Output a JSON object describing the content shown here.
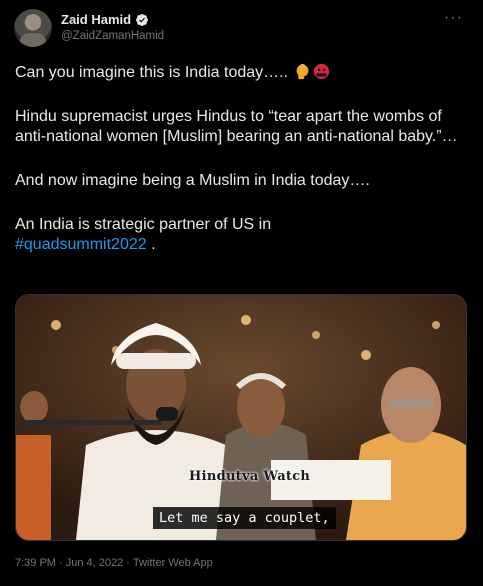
{
  "author": {
    "name": "Zaid Hamid",
    "handle": "@ZaidZamanHamid",
    "verified_icon": "verified-badge-icon"
  },
  "menu_icon": "more-options-icon",
  "tweet": {
    "line1": "Can you imagine this is India today…..",
    "line2": "Hindu supremacist urges Hindus to  “tear apart the wombs of anti-national women [Muslim] bearing an anti-national baby.”…",
    "line3": "And now imagine being a Muslim in India today….",
    "line4_prefix": "An India is strategic partner of US in",
    "hashtag": "#quadsummit2022",
    "line4_suffix": " .",
    "emojis": [
      "facepalming-person-emoji",
      "angry-face-with-symbols-emoji"
    ]
  },
  "media": {
    "watermark": "Hindutva Watch",
    "subtitle": "Let me say a couplet,"
  },
  "meta": {
    "time": "7:39 PM",
    "date": "Jun 4, 2022",
    "source": "Twitter Web App"
  },
  "colors": {
    "background": "#000000",
    "text": "#e7e9ea",
    "secondary": "#71767b",
    "link": "#1d9bf0"
  }
}
